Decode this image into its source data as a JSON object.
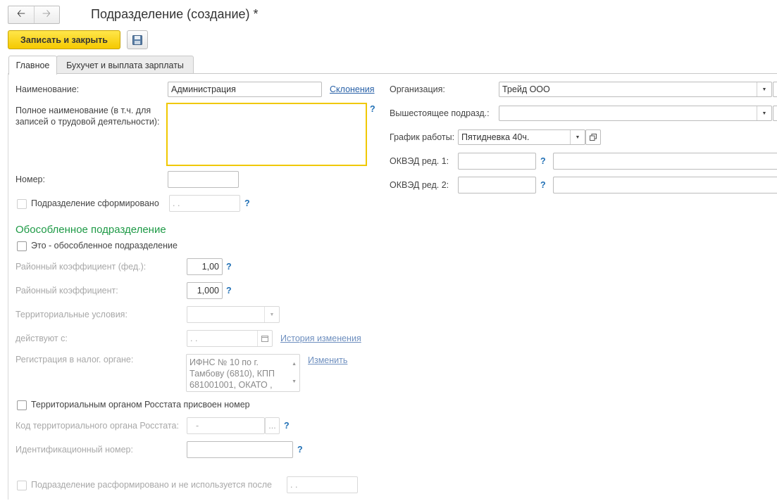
{
  "window": {
    "title": "Подразделение (создание) *",
    "back_icon": "arrow-left-icon",
    "forward_icon": "arrow-right-icon"
  },
  "toolbar": {
    "save_close_label": "Записать и закрыть",
    "save_icon": "floppy-disk-icon"
  },
  "tabs": [
    {
      "label": "Главное",
      "active": true
    },
    {
      "label": "Бухучет и выплата зарплаты",
      "active": false
    }
  ],
  "form": {
    "name_label": "Наименование:",
    "name_value": "Администрация",
    "declensions_link": "Склонения",
    "full_name_label_line1": "Полное наименование (в т.ч. для",
    "full_name_label_line2": "записей о трудовой деятельности):",
    "full_name_value": "",
    "help_mark": "?",
    "number_label": "Номер:",
    "number_value": "",
    "formed_label": "Подразделение сформировано",
    "formed_date": "  .  .",
    "organization_label": "Организация:",
    "organization_value": "Трейд ООО",
    "parent_label": "Вышестоящее подразд.:",
    "parent_value": "",
    "schedule_label": "График работы:",
    "schedule_value": "Пятидневка 40ч.",
    "okved1_label": "ОКВЭД ред. 1:",
    "okved2_label": "ОКВЭД ред. 2:",
    "okved1_code": "",
    "okved1_name": "",
    "okved2_code": "",
    "okved2_name": ""
  },
  "separate_section": {
    "title": "Обособленное подразделение",
    "is_separate_label": "Это - обособленное подразделение",
    "regional_coef_fed_label": "Районный коэффициент (фед.):",
    "regional_coef_fed_value": "1,00",
    "regional_coef_label": "Районный коэффициент:",
    "regional_coef_value": "1,000",
    "territorial_conditions_label": "Территориальные условия:",
    "territorial_conditions_value": "",
    "valid_from_label": "действуют с:",
    "valid_from_value": "  .  .",
    "history_link": "История изменения",
    "tax_registration_label": "Регистрация в налог. органе:",
    "tax_registration_value": "ИФНС № 10 по г. Тамбову (6810), КПП 681001001, ОКАТО ,",
    "change_link": "Изменить",
    "rosstat_number_label": "Территориальным органом Росстата присвоен номер",
    "rosstat_code_label": "Код территориального органа Росстата:",
    "rosstat_code_value": "-",
    "ellipsis": "...",
    "id_number_label": "Идентификационный номер:",
    "id_number_value": "",
    "disbanded_label": "Подразделение расформировано и не используется после",
    "disbanded_date": "  .  ."
  }
}
